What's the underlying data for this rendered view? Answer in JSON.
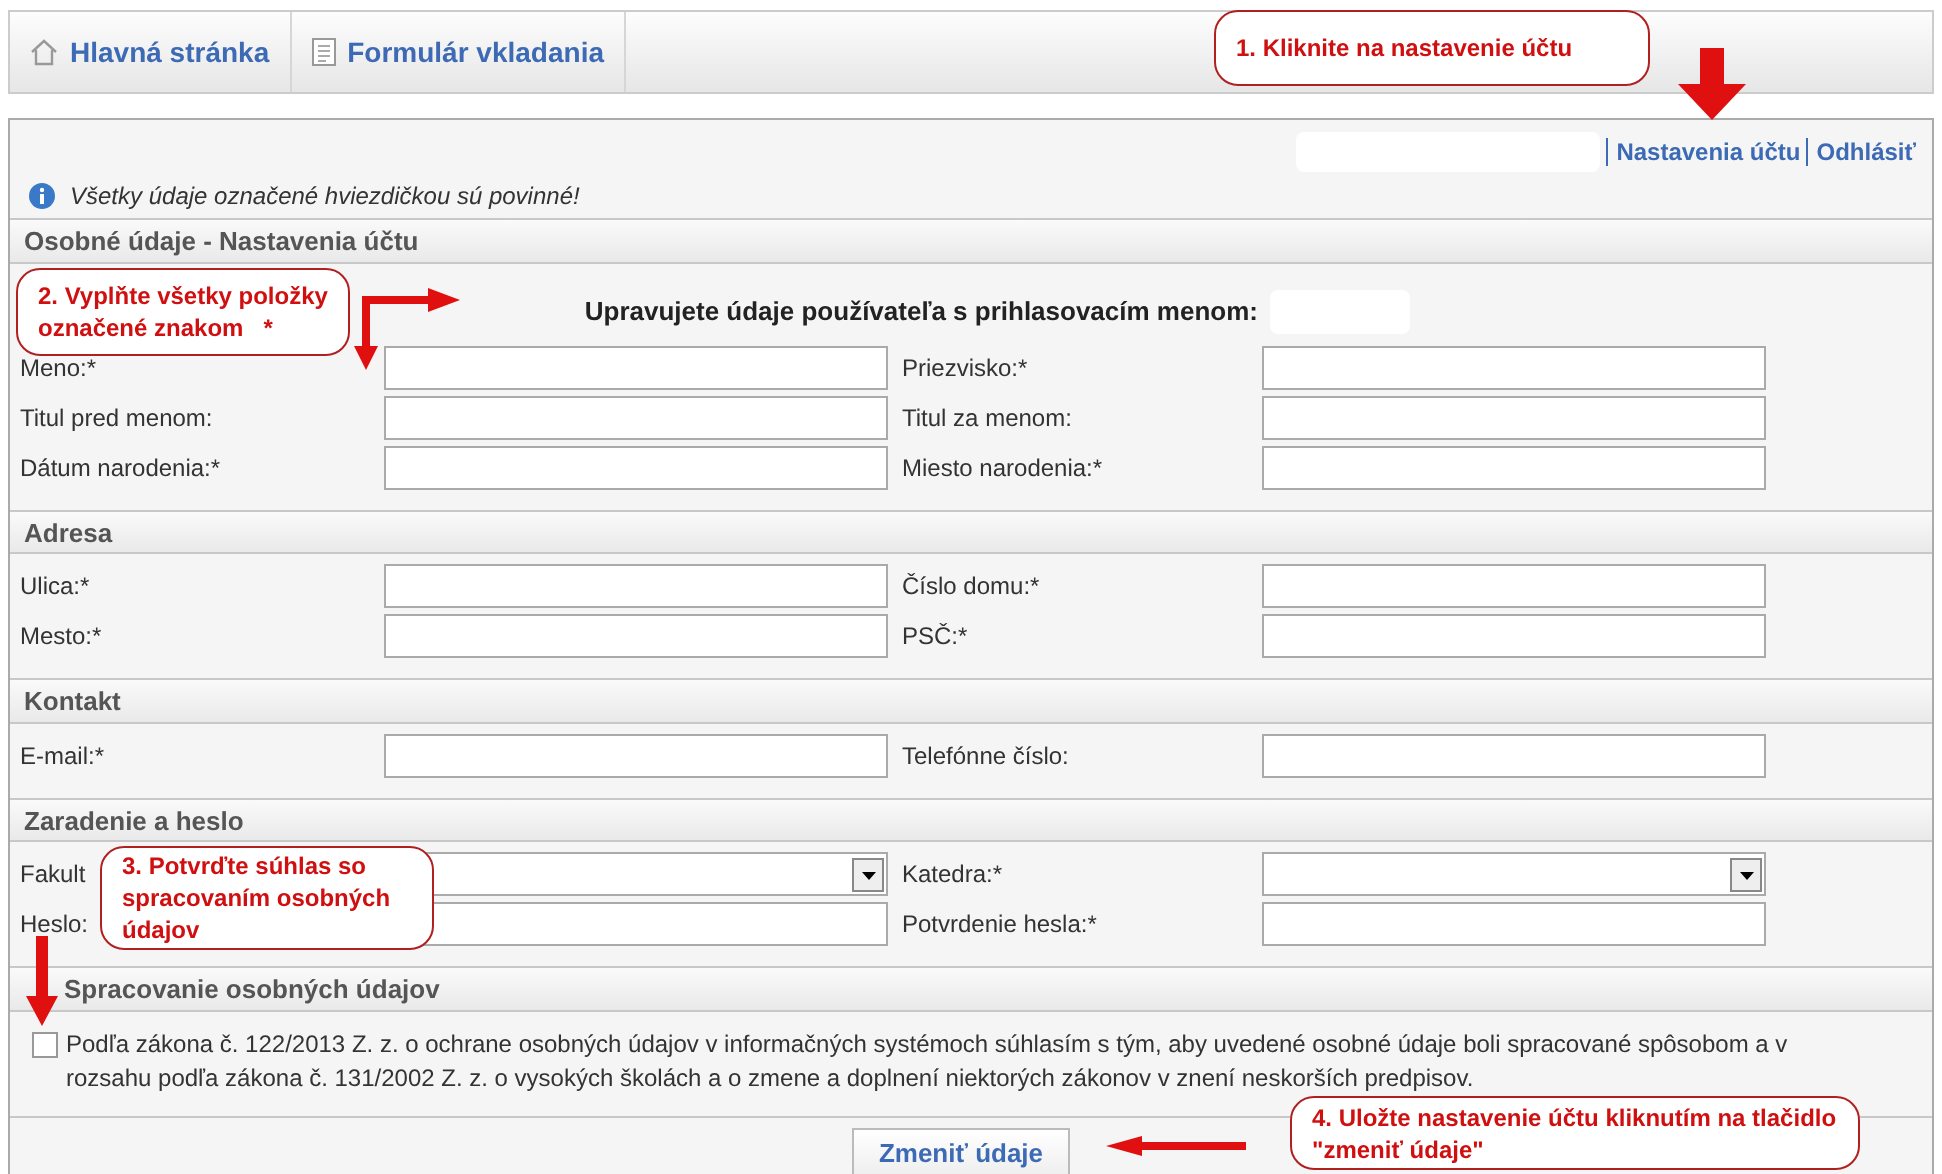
{
  "nav_tabs": [
    {
      "label": "Hlavná stránka",
      "kind": "home"
    },
    {
      "label": "Formulár vkladania",
      "kind": "document"
    }
  ],
  "user_links": [
    "Nastavenia účtu",
    "Odhlásiť"
  ],
  "notice": "Všetky údaje označené hviezdičkou sú povinné!",
  "sections": [
    {
      "title": "Osobné údaje - Nastavenia účtu",
      "intro": "Upravujete údaje používateľa s prihlasovacím menom:",
      "fields": [
        {
          "label": "Meno:*",
          "kind": "text"
        },
        {
          "label": "Priezvisko:*",
          "kind": "text"
        },
        {
          "label": "Titul pred menom:",
          "kind": "text"
        },
        {
          "label": "Titul za menom:",
          "kind": "text"
        },
        {
          "label": "Dátum narodenia:*",
          "kind": "text"
        },
        {
          "label": "Miesto narodenia:*",
          "kind": "text"
        }
      ]
    },
    {
      "title": "Adresa",
      "fields": [
        {
          "label": "Ulica:*",
          "kind": "text"
        },
        {
          "label": "Číslo domu:*",
          "kind": "text"
        },
        {
          "label": "Mesto:*",
          "kind": "text"
        },
        {
          "label": "PSČ:*",
          "kind": "text"
        }
      ]
    },
    {
      "title": "Kontakt",
      "fields": [
        {
          "label": "E-mail:*",
          "kind": "text"
        },
        {
          "label": "Telefónne číslo:",
          "kind": "text"
        }
      ]
    },
    {
      "title": "Zaradenie a heslo",
      "fields": [
        {
          "label": "Fakult",
          "kind": "select"
        },
        {
          "label": "Katedra:*",
          "kind": "select"
        },
        {
          "label": "Heslo:",
          "kind": "text"
        },
        {
          "label": "Potvrdenie hesla:*",
          "kind": "text"
        }
      ]
    },
    {
      "title": "Spracovanie osobných údajov",
      "consent": {
        "checked": false,
        "text": "Podľa zákona č. 122/2013 Z. z. o ochrane osobných údajov v informačných systémoch súhlasím s tým, aby uvedené osobné údaje boli spracované spôsobom a v rozsahu podľa zákona č. 131/2002 Z. z. o vysokých školách a o zmene a doplnení niektorých zákonov v znení neskorších predpisov."
      }
    }
  ],
  "submit": "Zmeniť údaje",
  "callouts": [
    "1. Kliknite na nastavenie účtu",
    "2. Vyplňte všetky položky označené znakom   *",
    "3. Potvrďte súhlas so spracovaním osobných údajov",
    "4. Uložte nastavenie účtu kliknutím na tlačidlo \"zmeniť údaje\""
  ]
}
